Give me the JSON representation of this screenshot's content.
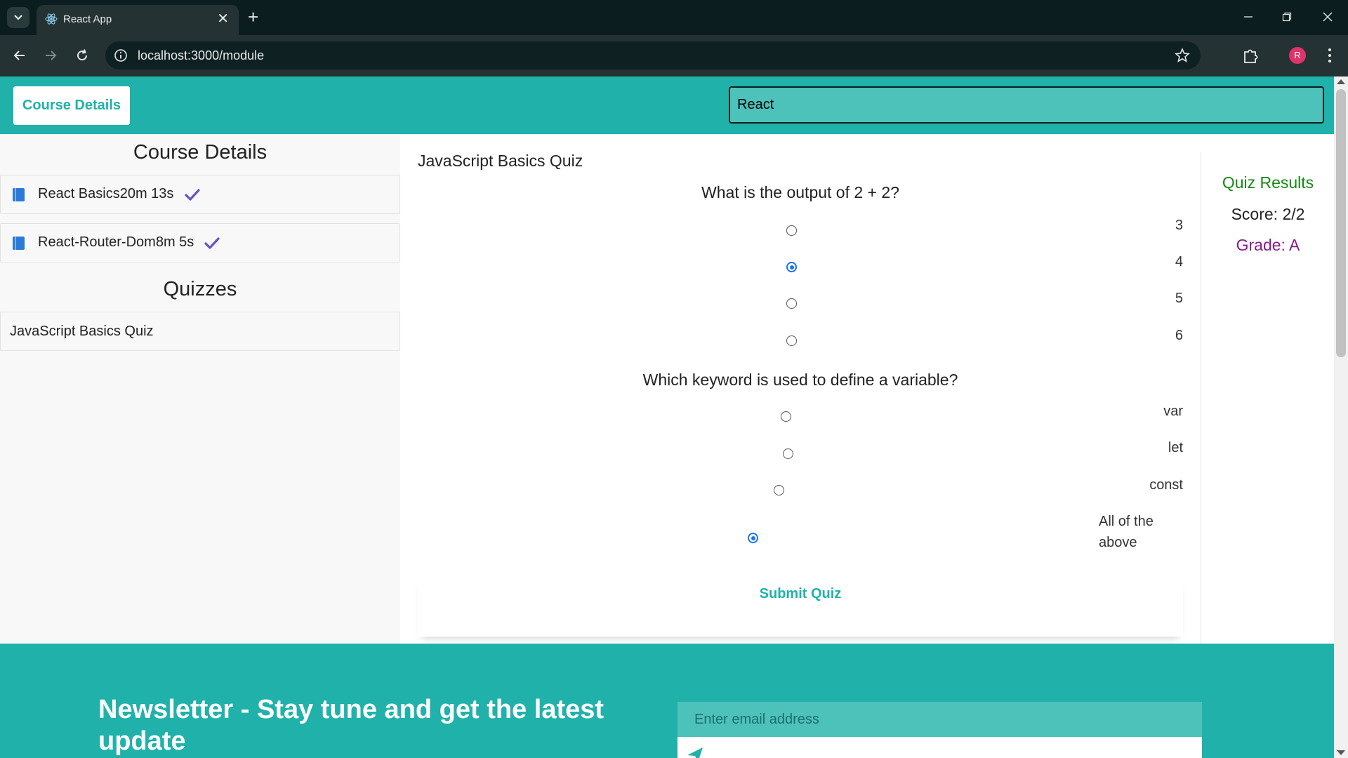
{
  "browser": {
    "tab_title": "React App",
    "url": "localhost:3000/module",
    "profile_initial": "R",
    "icons": {
      "tab_search": "chevron-down-icon",
      "favicon": "react-logo-icon",
      "close_tab": "close-icon",
      "new_tab": "plus-icon",
      "back": "arrow-left-icon",
      "forward": "arrow-right-icon",
      "reload": "reload-icon",
      "site_info": "info-icon",
      "bookmark": "star-icon",
      "extensions": "puzzle-icon",
      "menu": "kebab-menu-icon"
    },
    "new_tab_glyph": "+",
    "close_glyph": "✕"
  },
  "header": {
    "course_button": "Course Details",
    "search_value": "React"
  },
  "sidebar": {
    "course_heading": "Course Details",
    "lessons": [
      {
        "label": "React Basics20m 13s",
        "completed": true
      },
      {
        "label": "React-Router-Dom8m 5s",
        "completed": true
      }
    ],
    "quizzes_heading": "Quizzes",
    "quizzes": [
      {
        "label": "JavaScript Basics Quiz"
      }
    ]
  },
  "quiz": {
    "title": "JavaScript Basics Quiz",
    "questions": [
      {
        "text": "What is the output of 2 + 2?",
        "options": [
          "3",
          "4",
          "5",
          "6"
        ],
        "selected": 1
      },
      {
        "text": "Which keyword is used to define a variable?",
        "options": [
          "var",
          "let",
          "const",
          "All of the above"
        ],
        "selected": 3
      }
    ],
    "submit_label": "Submit Quiz"
  },
  "results": {
    "title": "Quiz Results",
    "score": "Score: 2/2",
    "grade": "Grade: A"
  },
  "footer": {
    "newsletter_title": "Newsletter - Stay tune and get the latest update",
    "email_placeholder": "Enter email address"
  },
  "colors": {
    "accent": "#20b2aa",
    "results_title": "#138a13",
    "grade": "#8b1a8b",
    "radio_checked": "#1a73e8",
    "check": "#6a4fc9"
  }
}
